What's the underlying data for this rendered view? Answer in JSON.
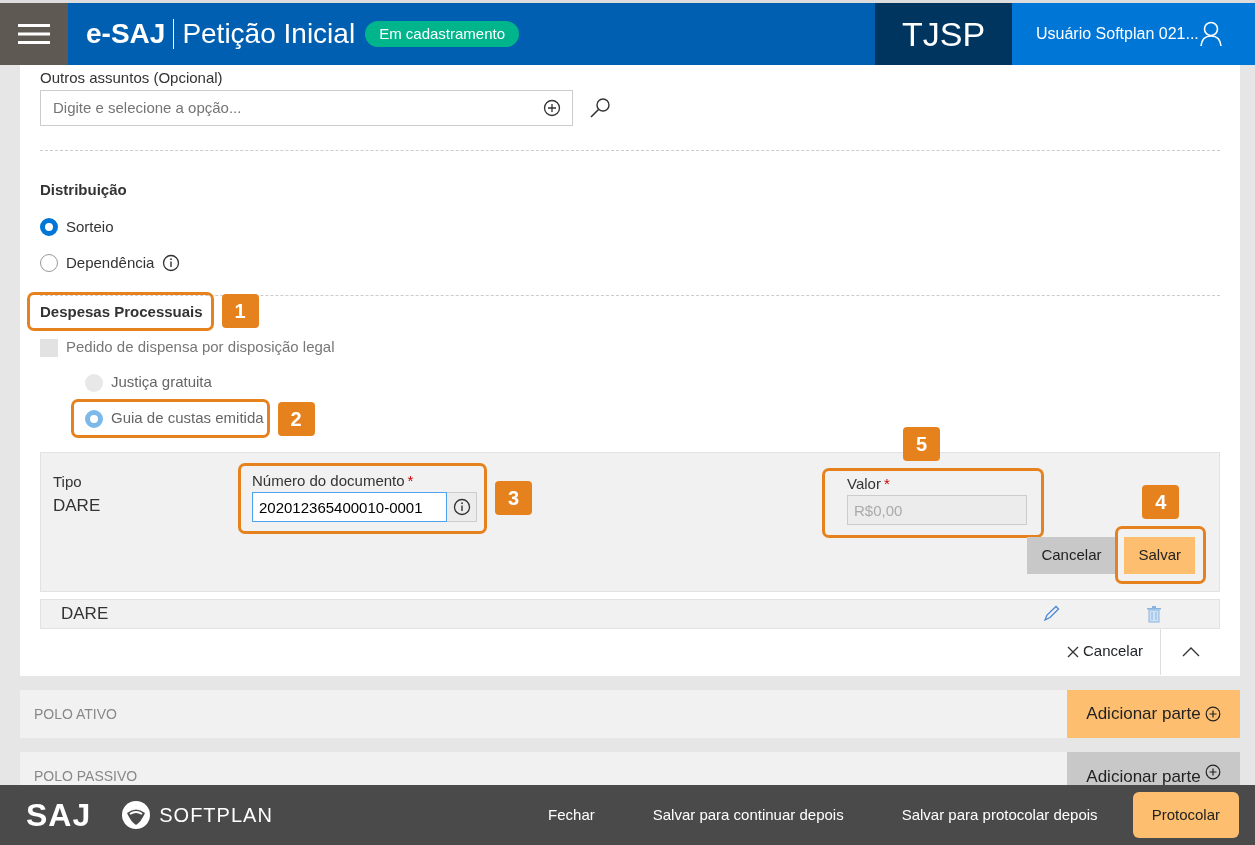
{
  "header": {
    "app": "e-SAJ",
    "title": "Petição Inicial",
    "status": "Em cadastramento",
    "court": "TJSP",
    "user": "Usuário Softplan 021..."
  },
  "outros_assuntos": {
    "label": "Outros assuntos (Opcional)",
    "placeholder": "Digite e selecione a opção..."
  },
  "distribuicao": {
    "label": "Distribuição",
    "options": [
      {
        "label": "Sorteio",
        "selected": true
      },
      {
        "label": "Dependência",
        "selected": false,
        "info": true
      }
    ]
  },
  "despesas": {
    "label": "Despesas Processuais",
    "callout": "1",
    "dispensa": {
      "label": "Pedido de dispensa por disposição legal",
      "checked": false,
      "disabled": true
    },
    "options": [
      {
        "label": "Justiça gratuita",
        "selected": false,
        "disabled": true
      },
      {
        "label": "Guia de custas emitida",
        "selected": true,
        "disabled": true,
        "callout": "2"
      }
    ]
  },
  "guia_form": {
    "tipo_label": "Tipo",
    "tipo_value": "DARE",
    "numero": {
      "label": "Número do documento",
      "required_mark": "*",
      "value": "202012365400010-0001",
      "callout": "3"
    },
    "valor": {
      "label": "Valor",
      "required_mark": "*",
      "value": "R$0,00",
      "disabled": true,
      "callout": "5"
    },
    "buttons": [
      {
        "label": "Cancelar",
        "kind": "secondary"
      },
      {
        "label": "Salvar",
        "kind": "primary",
        "callout": "4"
      }
    ]
  },
  "guias": [
    {
      "tipo": "DARE"
    }
  ],
  "section_cancel": "Cancelar",
  "polos": [
    {
      "label": "POLO ATIVO",
      "button": "Adicionar parte",
      "disabled": false
    },
    {
      "label": "POLO PASSIVO",
      "button": "Adicionar parte",
      "disabled": true
    }
  ],
  "footer": {
    "logos": [
      "SAJ",
      "SOFTPLAN"
    ],
    "actions": [
      {
        "label": "Fechar",
        "kind": "link"
      },
      {
        "label": "Salvar para continuar depois",
        "kind": "link"
      },
      {
        "label": "Salvar para protocolar depois",
        "kind": "link"
      },
      {
        "label": "Protocolar",
        "kind": "primary"
      }
    ]
  }
}
